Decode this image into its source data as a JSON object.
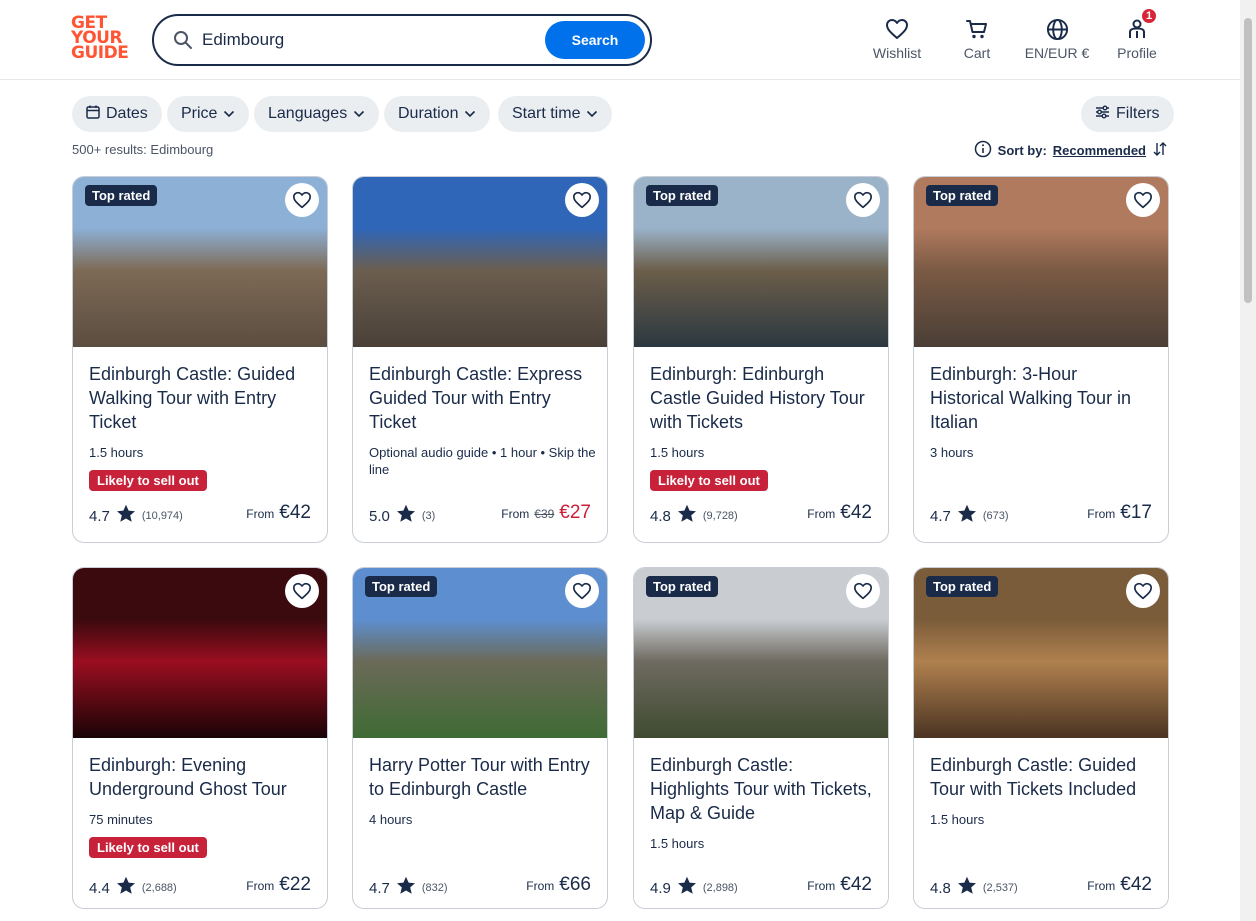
{
  "header": {
    "logo_lines": [
      "GET",
      "YOUR",
      "GUIDE"
    ],
    "search_value": "Edimbourg",
    "search_button": "Search",
    "nav": {
      "wishlist": "Wishlist",
      "cart": "Cart",
      "language": "EN/EUR €",
      "profile": "Profile",
      "profile_badge": "1"
    }
  },
  "filters": {
    "dates": "Dates",
    "price": "Price",
    "languages": "Languages",
    "duration": "Duration",
    "start_time": "Start time",
    "filters": "Filters"
  },
  "results_text": "500+ results: Edimbourg",
  "sort": {
    "label": "Sort by:",
    "value": "Recommended"
  },
  "cards": [
    {
      "top_rated": "Top rated",
      "title": "Edinburgh Castle: Guided Walking Tour with Entry Ticket",
      "meta": "1.5 hours",
      "sell_out": "Likely to sell out",
      "rating": "4.7",
      "count": "(10,974)",
      "from": "From",
      "old_price": "",
      "price": "€42",
      "image_colors": [
        "#8db0d6",
        "#7d6a55",
        "#5b4d40"
      ]
    },
    {
      "top_rated": "",
      "title": "Edinburgh Castle: Express Guided Tour with Entry Ticket",
      "meta": "Optional audio guide • 1 hour • Skip the line",
      "sell_out": "",
      "rating": "5.0",
      "count": "(3)",
      "from": "From",
      "old_price": "€39",
      "price": "€27",
      "image_colors": [
        "#2f66b8",
        "#6b5e4f",
        "#4a4038"
      ]
    },
    {
      "top_rated": "Top rated",
      "title": "Edinburgh: Edinburgh Castle Guided History Tour with Tickets",
      "meta": "1.5 hours",
      "sell_out": "Likely to sell out",
      "rating": "4.8",
      "count": "(9,728)",
      "from": "From",
      "old_price": "",
      "price": "€42",
      "image_colors": [
        "#9ab3c9",
        "#6c5e4a",
        "#2b3840"
      ]
    },
    {
      "top_rated": "Top rated",
      "title": "Edinburgh: 3-Hour Historical Walking Tour in Italian",
      "meta": "3 hours",
      "sell_out": "",
      "rating": "4.7",
      "count": "(673)",
      "from": "From",
      "old_price": "",
      "price": "€17",
      "image_colors": [
        "#b07a5e",
        "#7a5a44",
        "#4a3e36"
      ]
    },
    {
      "top_rated": "",
      "title": "Edinburgh: Evening Underground Ghost Tour",
      "meta": "75 minutes",
      "sell_out": "Likely to sell out",
      "rating": "4.4",
      "count": "(2,688)",
      "from": "From",
      "old_price": "",
      "price": "€22",
      "image_colors": [
        "#3a0a0e",
        "#9a0e20",
        "#1a0406"
      ]
    },
    {
      "top_rated": "Top rated",
      "title": "Harry Potter Tour with Entry to Edinburgh Castle",
      "meta": "4 hours",
      "sell_out": "",
      "rating": "4.7",
      "count": "(832)",
      "from": "From",
      "old_price": "",
      "price": "€66",
      "image_colors": [
        "#5d8fd0",
        "#6b6a58",
        "#3f6b34"
      ]
    },
    {
      "top_rated": "Top rated",
      "title": "Edinburgh Castle: Highlights Tour with Tickets, Map & Guide",
      "meta": "1.5 hours",
      "sell_out": "",
      "rating": "4.9",
      "count": "(2,898)",
      "from": "From",
      "old_price": "",
      "price": "€42",
      "image_colors": [
        "#c9cdd2",
        "#6e6a60",
        "#3f4a30"
      ]
    },
    {
      "top_rated": "Top rated",
      "title": "Edinburgh Castle: Guided Tour with Tickets Included",
      "meta": "1.5 hours",
      "sell_out": "",
      "rating": "4.8",
      "count": "(2,537)",
      "from": "From",
      "old_price": "",
      "price": "€42",
      "image_colors": [
        "#7a5c3a",
        "#b0804e",
        "#4a3422"
      ]
    }
  ]
}
